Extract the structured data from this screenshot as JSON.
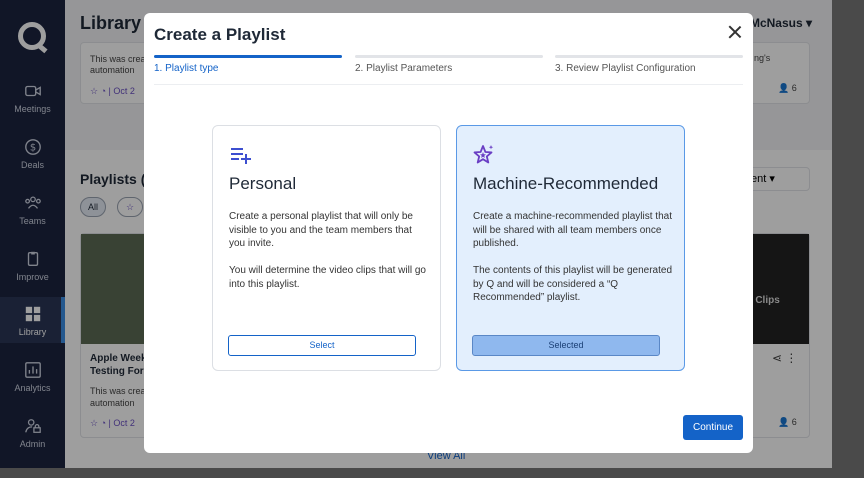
{
  "app": {
    "nav": [
      {
        "label": "Meetings",
        "icon": "video-camera-icon"
      },
      {
        "label": "Deals",
        "icon": "dollar-circle-icon"
      },
      {
        "label": "Teams",
        "icon": "people-icon"
      },
      {
        "label": "Improve",
        "icon": "clipboard-icon"
      },
      {
        "label": "Library",
        "icon": "grid-icon"
      },
      {
        "label": "Analytics",
        "icon": "bar-chart-icon"
      },
      {
        "label": "Admin",
        "icon": "user-lock-icon"
      }
    ],
    "library_title": "Library",
    "user_name": "McNasus",
    "bg_card_top": {
      "text1": "This was crea",
      "text2": "automation",
      "date": "| Oct 2",
      "right_text": "ng's",
      "count": "6"
    },
    "playlists_heading": "Playlists (",
    "filter_all": "All",
    "sort_select": "ent",
    "bg_card_bottom": {
      "title1": "Apple Week",
      "title2": "Testing For",
      "text1": "This was crea",
      "text2": "automation",
      "date": "| Oct 2",
      "clips": "2 Clips",
      "count": "6"
    },
    "view_all": "View All"
  },
  "modal": {
    "title": "Create a Playlist",
    "steps": [
      {
        "label": "1. Playlist type"
      },
      {
        "label": "2. Playlist Parameters"
      },
      {
        "label": "3. Review Playlist Configuration"
      }
    ],
    "options": [
      {
        "title": "Personal",
        "icon": "playlist-add-icon",
        "desc1": "Create a personal playlist that will only be visible to you and the team members that you invite.",
        "desc2": "You will determine the video clips that will go into this playlist.",
        "button": "Select"
      },
      {
        "title": "Machine-Recommended",
        "icon": "sparkle-star-icon",
        "desc1": "Create a machine-recommended playlist that will be shared with all team members once published.",
        "desc2": "The contents of this playlist will be generated by Q and will be considered a “Q Recommended” playlist.",
        "button": "Selected"
      }
    ],
    "continue_label": "Continue"
  },
  "colors": {
    "accent": "#1463c8",
    "sidebar": "#1c2540",
    "selected_card": "#e3effd"
  }
}
